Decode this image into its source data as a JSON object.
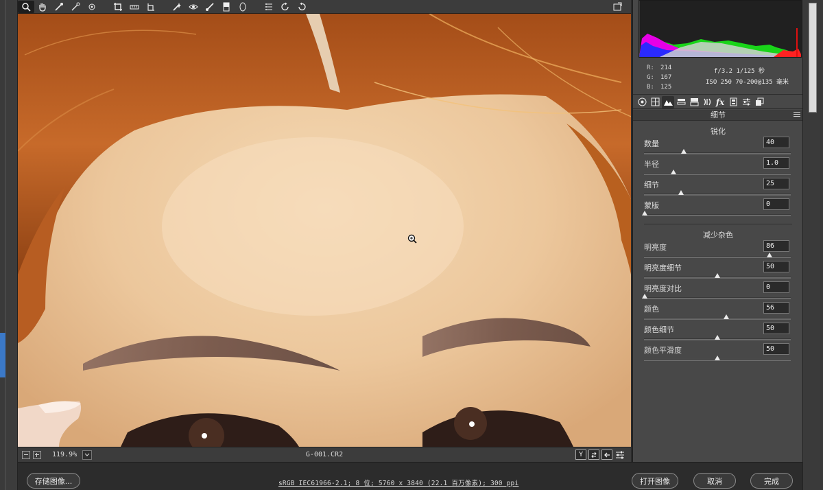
{
  "statusbar": {
    "zoom_value": "119.9%",
    "filename": "G-001.CR2",
    "view_buttons": [
      "Y",
      "",
      "",
      ""
    ]
  },
  "readouts": {
    "rgb": [
      {
        "key": "R:",
        "value": "214"
      },
      {
        "key": "G:",
        "value": "167"
      },
      {
        "key": "B:",
        "value": "125"
      }
    ],
    "camera_line1": "f/3.2  1/125 秒",
    "camera_line2": "ISO 250  70-200@135 毫米"
  },
  "panel": {
    "title": "细节",
    "sharpen_title": "锐化",
    "noise_title": "减少杂色",
    "sharpen": [
      {
        "label": "数量",
        "value": "40",
        "level": 0.267
      },
      {
        "label": "半径",
        "value": "1.0",
        "level": 0.2
      },
      {
        "label": "细节",
        "value": "25",
        "level": 0.25
      },
      {
        "label": "蒙版",
        "value": "0",
        "level": 0.0
      }
    ],
    "noise": [
      {
        "label": "明亮度",
        "value": "86",
        "level": 0.86
      },
      {
        "label": "明亮度细节",
        "value": "50",
        "level": 0.5
      },
      {
        "label": "明亮度对比",
        "value": "0",
        "level": 0.0
      },
      {
        "label": "颜色",
        "value": "56",
        "level": 0.56
      },
      {
        "label": "颜色细节",
        "value": "50",
        "level": 0.5
      },
      {
        "label": "颜色平滑度",
        "value": "50",
        "level": 0.5
      }
    ]
  },
  "bottom": {
    "save_label": "存储图像...",
    "workflow": "sRGB IEC61966-2.1; 8 位; 5760 x 3840 (22.1 百万像素); 300 ppi",
    "open_label": "打开图像",
    "cancel_label": "取消",
    "done_label": "完成"
  },
  "colors": {
    "panel_bg": "#484848",
    "frame_bg": "#3c3c3c",
    "accent_blue": "#3b79c8"
  }
}
